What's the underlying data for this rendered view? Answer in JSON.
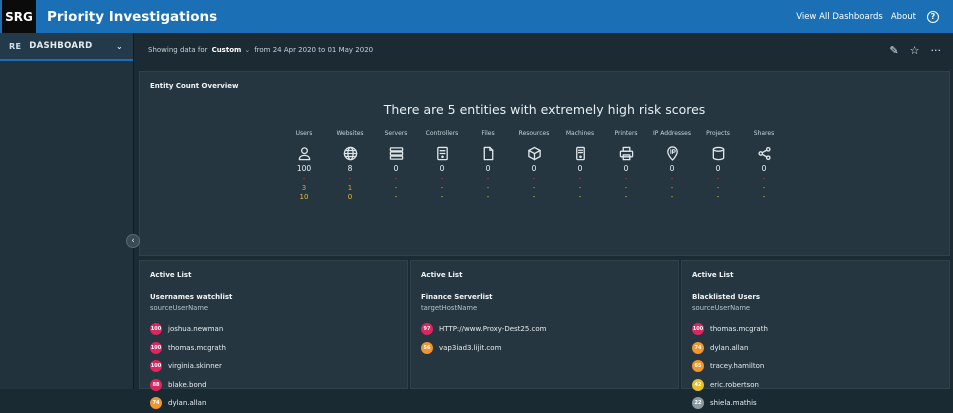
{
  "header": {
    "logo": "SRG",
    "title": "Priority Investigations",
    "view_all": "View All Dashboards",
    "about": "About",
    "help": "?"
  },
  "sidebar": {
    "item_icon": "RE",
    "item_label": "DASHBOARD",
    "chevron": "⌄"
  },
  "collapse_glyph": "‹",
  "filter": {
    "prefix": "Showing data for",
    "mode": "Custom",
    "dropdown": "⌄",
    "range": "from 24 Apr 2020 to 01 May 2020"
  },
  "tools": {
    "edit": "✎",
    "star": "☆",
    "more": "···"
  },
  "overview": {
    "title": "Entity Count Overview",
    "headline": "There are 5 entities with extremely high risk scores",
    "entities": [
      {
        "label": "Users",
        "icon": "user-icon",
        "total": "100",
        "red": "-",
        "orange": "3",
        "yellow": "10"
      },
      {
        "label": "Websites",
        "icon": "globe-icon",
        "total": "8",
        "red": "-",
        "orange": "1",
        "yellow": "0"
      },
      {
        "label": "Servers",
        "icon": "server-icon",
        "total": "0",
        "red": "-",
        "orange": "-",
        "yellow": "-"
      },
      {
        "label": "Controllers",
        "icon": "controller-icon",
        "total": "0",
        "red": "-",
        "orange": "-",
        "yellow": "-"
      },
      {
        "label": "Files",
        "icon": "file-icon",
        "total": "0",
        "red": "-",
        "orange": "-",
        "yellow": "-"
      },
      {
        "label": "Resources",
        "icon": "cube-icon",
        "total": "0",
        "red": "-",
        "orange": "-",
        "yellow": "-"
      },
      {
        "label": "Machines",
        "icon": "machine-icon",
        "total": "0",
        "red": "-",
        "orange": "-",
        "yellow": "-"
      },
      {
        "label": "Printers",
        "icon": "printer-icon",
        "total": "0",
        "red": "-",
        "orange": "-",
        "yellow": "-"
      },
      {
        "label": "IP Addresses",
        "icon": "ip-pin-icon",
        "total": "0",
        "red": "-",
        "orange": "-",
        "yellow": "-"
      },
      {
        "label": "Projects",
        "icon": "database-icon",
        "total": "0",
        "red": "-",
        "orange": "-",
        "yellow": "-"
      },
      {
        "label": "Shares",
        "icon": "share-icon",
        "total": "0",
        "red": "-",
        "orange": "-",
        "yellow": "-"
      }
    ]
  },
  "active_lists": [
    {
      "header": "Active List",
      "name": "Usernames watchlist",
      "field": "sourceUserName",
      "items": [
        {
          "score": "100",
          "label": "joshua.newman",
          "color": "#e0245e"
        },
        {
          "score": "100",
          "label": "thomas.mcgrath",
          "color": "#e0245e"
        },
        {
          "score": "100",
          "label": "virginia.skinner",
          "color": "#e0245e"
        },
        {
          "score": "88",
          "label": "blake.bond",
          "color": "#e0245e"
        },
        {
          "score": "74",
          "label": "dylan.allan",
          "color": "#f0962c"
        }
      ]
    },
    {
      "header": "Active List",
      "name": "Finance Serverlist",
      "field": "targetHostName",
      "items": [
        {
          "score": "97",
          "label": "HTTP://www.Proxy-Dest25.com",
          "color": "#e0245e"
        },
        {
          "score": "56",
          "label": "vap3iad3.lijit.com",
          "color": "#f0962c"
        }
      ]
    },
    {
      "header": "Active List",
      "name": "Blacklisted Users",
      "field": "sourceUserName",
      "items": [
        {
          "score": "100",
          "label": "thomas.mcgrath",
          "color": "#e0245e"
        },
        {
          "score": "74",
          "label": "dylan.allan",
          "color": "#f0962c"
        },
        {
          "score": "65",
          "label": "tracey.hamilton",
          "color": "#f0962c"
        },
        {
          "score": "42",
          "label": "eric.robertson",
          "color": "#e8c12a"
        },
        {
          "score": "22",
          "label": "shiela.mathis",
          "color": "#8c9aa2"
        }
      ]
    }
  ]
}
